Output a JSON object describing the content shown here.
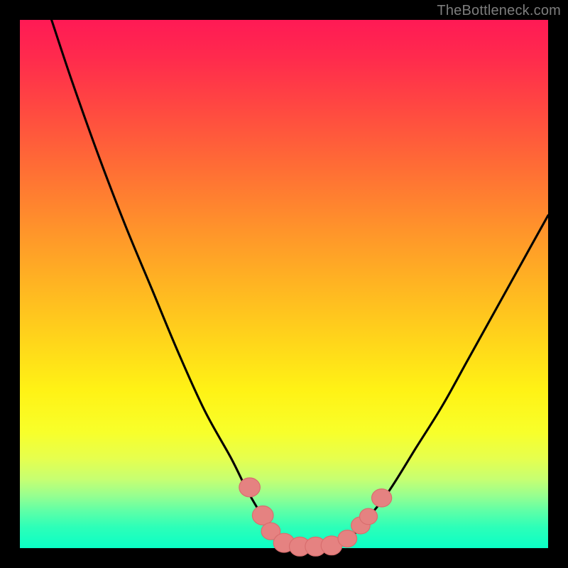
{
  "watermark": "TheBottleneck.com",
  "colors": {
    "frame": "#000000",
    "curve": "#000000",
    "bead_fill": "#e58281",
    "bead_stroke": "#d86e6e",
    "gradient_top": "#ff1a55",
    "gradient_bottom": "#0affc6"
  },
  "chart_data": {
    "type": "line",
    "title": "",
    "xlabel": "",
    "ylabel": "",
    "xlim": [
      0,
      100
    ],
    "ylim": [
      0,
      100
    ],
    "grid": false,
    "legend": false,
    "notes": "Gradient background from red (top, worst) to green (bottom, best). Black V-shaped bottleneck curve with salmon-colored marker beads near the valley. No axis ticks or numeric labels are rendered.",
    "series": [
      {
        "name": "bottleneck-curve",
        "x": [
          6,
          10,
          15,
          20,
          25,
          30,
          35,
          40,
          43,
          46,
          49,
          52,
          55,
          57,
          60,
          63,
          66,
          70,
          75,
          80,
          85,
          90,
          95,
          100
        ],
        "y": [
          100,
          88,
          74,
          61,
          49,
          37,
          26,
          17,
          11,
          6,
          2.5,
          0.8,
          0.2,
          0.2,
          0.7,
          2.4,
          5.8,
          11,
          19,
          27,
          36,
          45,
          54,
          63
        ]
      }
    ],
    "markers": [
      {
        "x": 43.5,
        "y": 11.5,
        "r": 1.9
      },
      {
        "x": 46.0,
        "y": 6.2,
        "r": 1.9
      },
      {
        "x": 47.5,
        "y": 3.2,
        "r": 1.7
      },
      {
        "x": 50.0,
        "y": 1.0,
        "r": 1.9
      },
      {
        "x": 53.0,
        "y": 0.3,
        "r": 1.9
      },
      {
        "x": 56.0,
        "y": 0.3,
        "r": 1.9
      },
      {
        "x": 59.0,
        "y": 0.5,
        "r": 1.9
      },
      {
        "x": 62.0,
        "y": 1.8,
        "r": 1.7
      },
      {
        "x": 64.5,
        "y": 4.3,
        "r": 1.7
      },
      {
        "x": 66.0,
        "y": 6.0,
        "r": 1.6
      },
      {
        "x": 68.5,
        "y": 9.5,
        "r": 1.8
      }
    ]
  }
}
